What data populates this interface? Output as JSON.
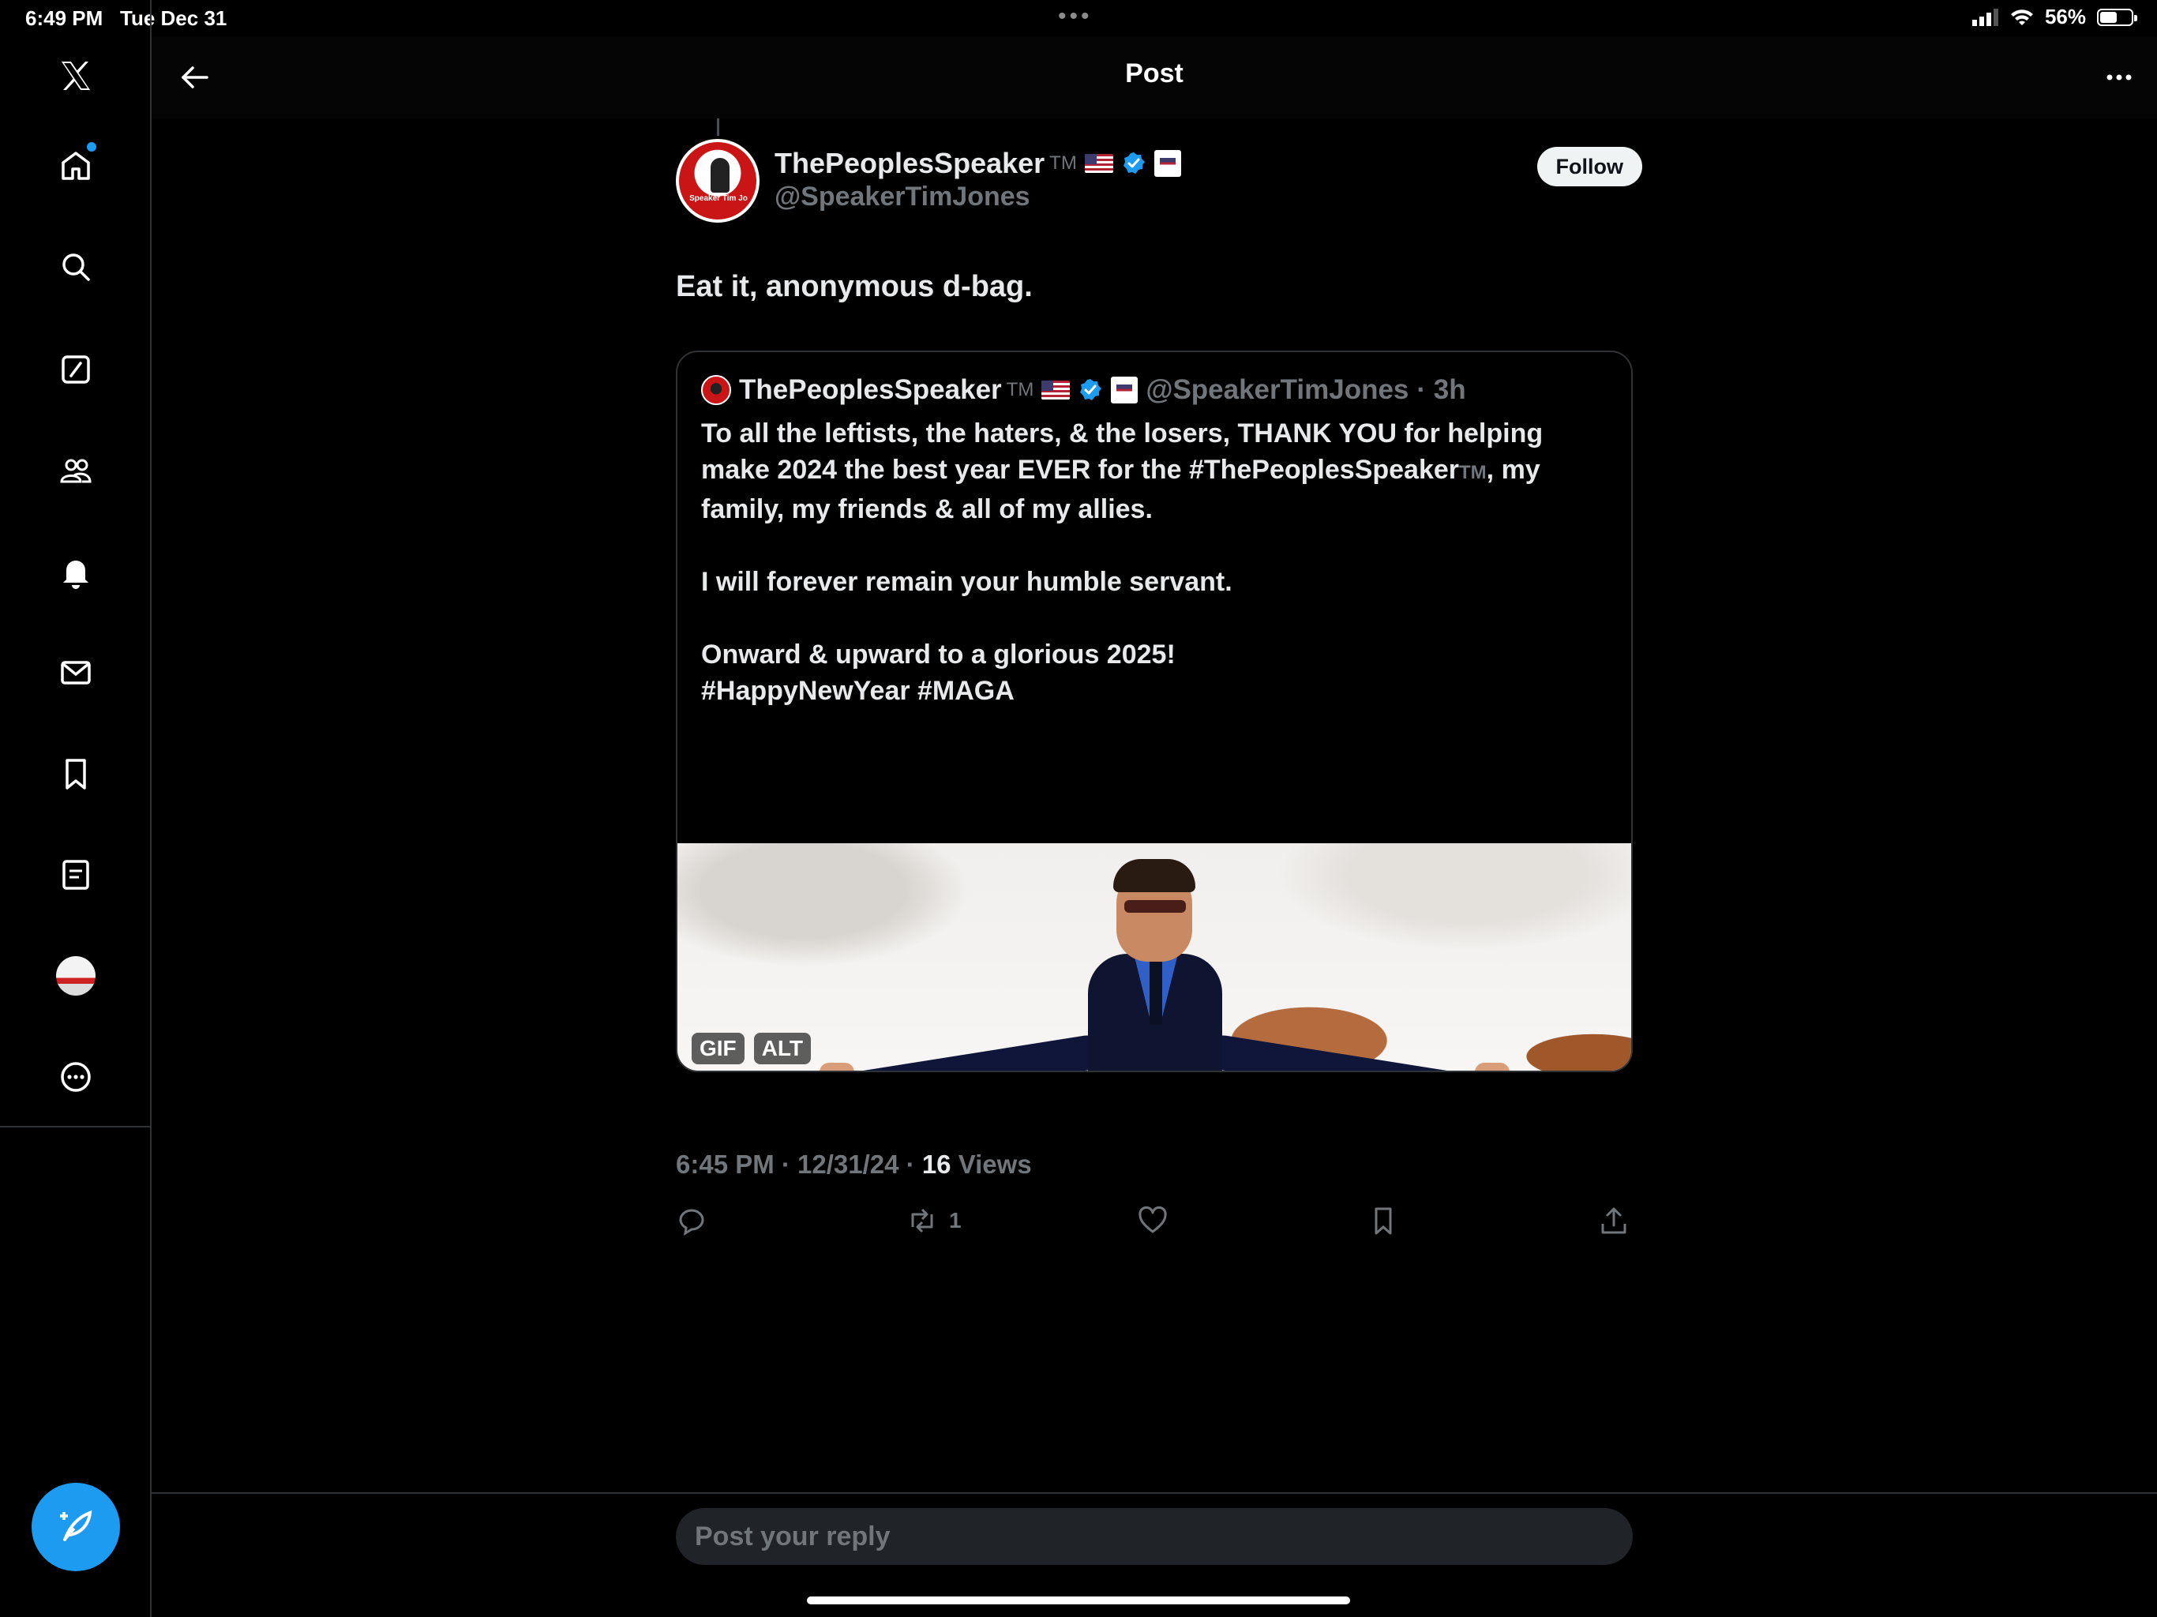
{
  "status_bar": {
    "time": "6:49 PM",
    "date": "Tue Dec 31",
    "battery": "56%",
    "battery_level": 0.56,
    "icons": [
      "cellular-signal-icon",
      "wifi-icon",
      "battery-icon"
    ]
  },
  "sidebar": {
    "items": [
      {
        "name": "x-logo-icon"
      },
      {
        "name": "home-icon",
        "has_badge": true
      },
      {
        "name": "search-icon"
      },
      {
        "name": "grok-icon"
      },
      {
        "name": "communities-icon"
      },
      {
        "name": "notifications-icon"
      },
      {
        "name": "messages-icon"
      },
      {
        "name": "bookmarks-icon"
      },
      {
        "name": "lists-icon"
      },
      {
        "name": "profile-avatar"
      },
      {
        "name": "more-icon"
      }
    ],
    "compose_icon": "compose-post-icon"
  },
  "header": {
    "title": "Post",
    "back_icon": "arrow-left-icon",
    "more_icon": "more-horizontal-icon"
  },
  "post": {
    "display_name": "ThePeoplesSpeaker",
    "tm": "TM",
    "handle": "@SpeakerTimJones",
    "follow_label": "Follow",
    "text": "Eat it, anonymous d-bag.",
    "avatar_text": "Speaker Tim Jo",
    "timestamp": "6:45 PM · 12/31/24 · ",
    "views_count": "16",
    "views_label": " Views",
    "actions": {
      "reply_count": "",
      "repost_count": "1",
      "like_count": "",
      "bookmark_count": ""
    }
  },
  "quote": {
    "display_name": "ThePeoplesSpeaker",
    "tm": "TM",
    "handle": "@SpeakerTimJones",
    "time": "· 3h",
    "line1": "To all the leftists, the haters, & the losers, THANK YOU for helping make 2024 the best year EVER for the #ThePeoplesSpeaker",
    "line1_tm": "TM",
    "line1_end": ", my family, my friends & all of my allies.",
    "line2": "I will forever remain your humble servant.",
    "line3": "Onward & upward to a glorious 2025!",
    "line4": "#HappyNewYear #MAGA",
    "media_badges": [
      "GIF",
      "ALT"
    ]
  },
  "reply": {
    "placeholder": "Post your reply"
  },
  "colors": {
    "background": "#000000",
    "accent": "#1d9bf0",
    "muted_text": "#71767b",
    "border": "#2f3336"
  }
}
